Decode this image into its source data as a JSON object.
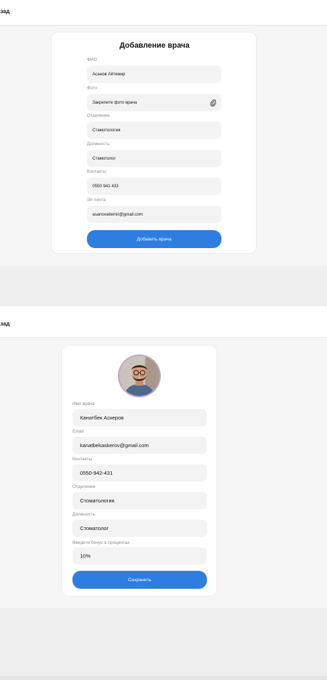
{
  "screen1": {
    "back_label": "азад",
    "title": "Добавление врача",
    "fields": [
      {
        "label": "ФИО",
        "value": "Асанов Айтемир"
      },
      {
        "label": "Фото",
        "value": "Закрепите фото врача"
      },
      {
        "label": "Отделение",
        "value": "Стамотология"
      },
      {
        "label": "Должность",
        "value": "Стамотолог"
      },
      {
        "label": "Контакты",
        "value": "0550 941 433"
      },
      {
        "label": "Эл почта",
        "value": "asanovaitemir@gmail.com"
      }
    ],
    "submit_label": "Добавить врача"
  },
  "screen2": {
    "back_label": "азад",
    "fields": [
      {
        "label": "Имя врача",
        "value": "Канатбек Аскеров"
      },
      {
        "label": "Email",
        "value": "kanatbekaskerov@gmail.com"
      },
      {
        "label": "Контакты",
        "value": "0550-942-431"
      },
      {
        "label": "Отделение",
        "value": "Стоматология"
      },
      {
        "label": "Должность",
        "value": "Стоматолог"
      },
      {
        "label": "Введите бонус в процентах",
        "value": "10%"
      }
    ],
    "save_label": "Сохранить"
  },
  "colors": {
    "accent": "#2e7de0",
    "field_bg": "#f3f3f3",
    "page_bg": "#f6f6f6"
  },
  "icons": [
    "paperclip-icon",
    "doctor-avatar"
  ]
}
